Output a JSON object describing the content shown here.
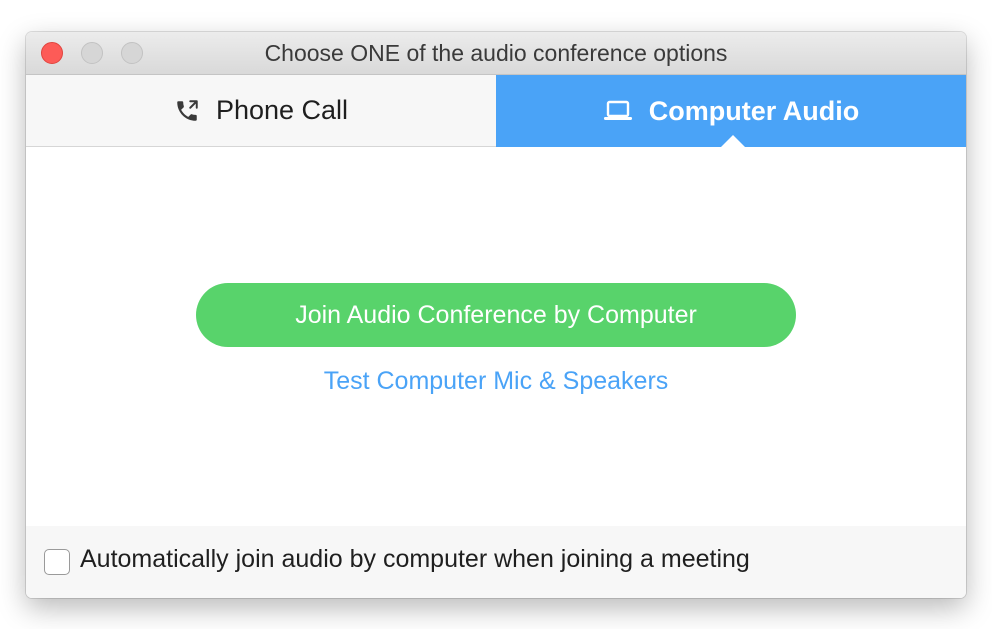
{
  "window": {
    "title": "Choose ONE of the audio conference options",
    "controls": [
      "close",
      "minimize",
      "zoom"
    ]
  },
  "tabs": [
    {
      "label": "Phone Call",
      "icon": "phone-icon",
      "selected": false
    },
    {
      "label": "Computer Audio",
      "icon": "laptop-icon",
      "selected": true
    }
  ],
  "main": {
    "join_button_label": "Join Audio Conference by Computer",
    "test_link_label": "Test Computer Mic & Speakers"
  },
  "footer": {
    "auto_join_label": "Automatically join audio by computer when joining a meeting",
    "auto_join_checked": false
  },
  "colors": {
    "accent_blue": "#4aa3f7",
    "join_green": "#58d36b",
    "close_red": "#fd5b57"
  }
}
